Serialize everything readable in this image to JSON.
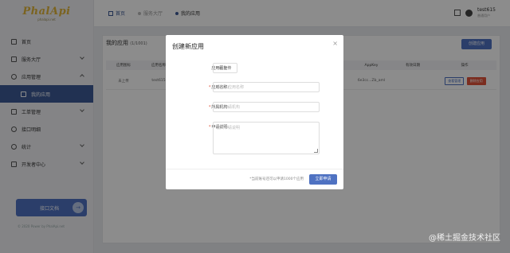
{
  "logo": {
    "text": "PhalApi",
    "tagline": "phalapi.net"
  },
  "sidebar": {
    "items": [
      {
        "label": "首页"
      },
      {
        "label": "服务大厅"
      },
      {
        "label": "应用管理"
      },
      {
        "label": "我的应用"
      },
      {
        "label": "工单管理"
      },
      {
        "label": "接口明细"
      },
      {
        "label": "统计"
      },
      {
        "label": "开发者中心"
      }
    ],
    "api_doc_label": "接口文档",
    "api_doc_icon": "→",
    "copyright": "© 2020 Power by PhalApi.net"
  },
  "topbar": {
    "crumb_home": "首页",
    "crumb_prev": "服务大厅",
    "crumb_active": "我的应用",
    "username": "test615",
    "role": "普通用户"
  },
  "page": {
    "title": "我的应用",
    "count": "(1/1001)",
    "create_label": "创建应用",
    "columns": [
      "应用图标",
      "应用名称",
      "应用编号",
      "所属机构",
      "申请说明",
      "应用状态",
      "AppKey",
      "有效日期",
      "操作"
    ],
    "row": {
      "icon": "未上传",
      "name": "test615",
      "org": "",
      "desc": "",
      "status": "",
      "appkey": "6e3cc...Zb_aml",
      "date": "",
      "manage": "查看管理",
      "delete": "删除应用"
    }
  },
  "modal": {
    "title": "创建新应用",
    "close": "×",
    "icon_label": "应用图标:",
    "upload_label": "+ 上传",
    "name_label": "应用名称:",
    "name_placeholder": "请输入应用名称",
    "org_label": "所属机构:",
    "org_placeholder": "输入申请机构",
    "desc_label": "申请说明:",
    "desc_placeholder": "输入申请说明",
    "note": "*当前账号还可以申请1000个应用",
    "apply_label": "立即申请"
  },
  "watermark": "@稀土掘金技术社区"
}
